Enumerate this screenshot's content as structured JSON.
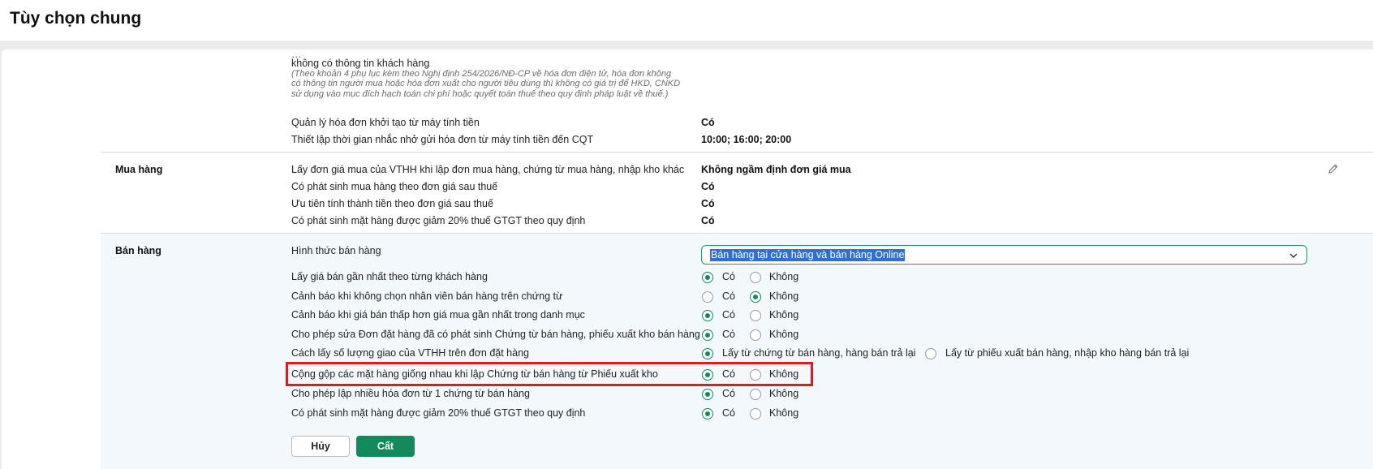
{
  "page": {
    "title": "Tùy chọn chung"
  },
  "top": {
    "cut_text": "không có thông tin khách hàng",
    "note": "(Theo khoản 4 phụ lục kèm theo Nghị định 254/2026/NĐ-CP về hóa đơn điện tử, hóa đơn không có thông tin người mua hoặc hóa đơn xuất cho người tiêu dùng thì không có giá trị để HKD, CNKD sử dụng vào mục đích hạch toán chi phí hoặc quyết toán thuế theo quy định pháp luật về thuế.)",
    "rows": [
      {
        "label": "Quản lý hóa đơn khởi tạo từ máy tính tiền",
        "value": "Có"
      },
      {
        "label": "Thiết lập thời gian nhắc nhở gửi hóa đơn từ máy tính tiền đến CQT",
        "value": "10:00; 16:00; 20:00"
      }
    ]
  },
  "mua_hang": {
    "title": "Mua hàng",
    "edit_icon": "pencil-icon",
    "rows": [
      {
        "label": "Lấy đơn giá mua của VTHH khi lập đơn mua hàng, chứng từ mua hàng, nhập kho khác",
        "value": "Không ngầm định đơn giá mua"
      },
      {
        "label": "Có phát sinh mua hàng theo đơn giá sau thuế",
        "value": "Có"
      },
      {
        "label": "Ưu tiên tính thành tiền theo đơn giá sau thuế",
        "value": "Có"
      },
      {
        "label": "Có phát sinh mặt hàng được giảm 20% thuế GTGT theo quy định",
        "value": "Có"
      }
    ]
  },
  "ban_hang": {
    "title": "Bán hàng",
    "hinh_thuc": {
      "label": "Hình thức bán hàng",
      "selected": "Bán hàng tại cửa hàng và bán hàng Online"
    },
    "yes_label": "Có",
    "no_label": "Không",
    "rows": [
      {
        "label": "Lấy giá bán gần nhất theo từng khách hàng",
        "selected": "yes"
      },
      {
        "label": "Cảnh báo khi không chọn nhân viên bán hàng trên chứng từ",
        "selected": "no"
      },
      {
        "label": "Cảnh báo khi giá bán thấp hơn giá mua gần nhất trong danh mục",
        "selected": "yes"
      },
      {
        "label": "Cho phép sửa Đơn đặt hàng đã có phát sinh Chứng từ bán hàng, phiếu xuất kho bán hàng",
        "selected": "yes"
      },
      {
        "label": "Cách lấy số lượng giao của VTHH trên đơn đặt hàng",
        "selected": "opt1",
        "opt1_label": "Lấy từ chứng từ bán hàng, hàng bán trả lại",
        "opt2_label": "Lấy từ phiếu xuất bán hàng, nhập kho hàng bán trả lại"
      },
      {
        "label": "Cộng gộp các mặt hàng giống nhau khi lập Chứng từ bán hàng từ Phiếu xuất kho",
        "selected": "yes"
      },
      {
        "label": "Cho phép lập nhiều hóa đơn từ 1 chứng từ bán hàng",
        "selected": "yes"
      },
      {
        "label": "Có phát sinh mặt hàng được giảm 20% thuế GTGT theo quy định",
        "selected": "yes"
      }
    ],
    "cancel_label": "Hủy",
    "save_label": "Cất"
  },
  "colors": {
    "accent": "#148a5c",
    "highlight": "#e11b1b",
    "selection": "#2f6fd1"
  }
}
